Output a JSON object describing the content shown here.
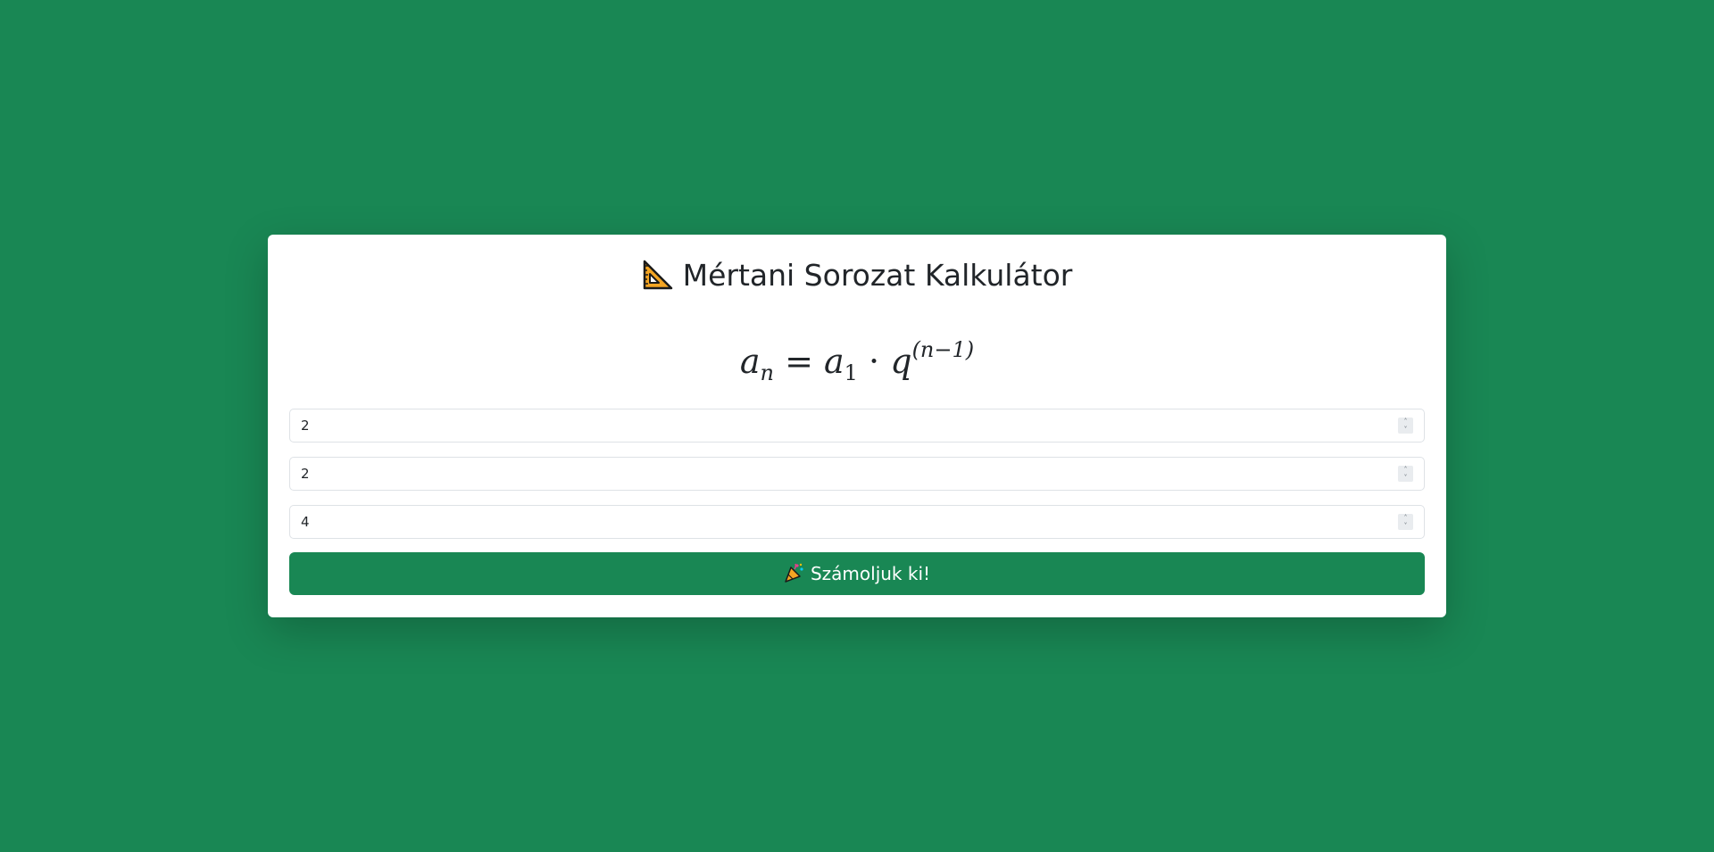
{
  "colors": {
    "background": "#198754",
    "card": "#ffffff",
    "button": "#198754",
    "button_text": "#ffffff"
  },
  "header": {
    "icon": "triangular-ruler-icon",
    "title": "Mértani Sorozat Kalkulátor"
  },
  "formula": {
    "a": "a",
    "n_sub": "n",
    "equals": "=",
    "a1": "a",
    "one_sub": "1",
    "dot": "·",
    "q": "q",
    "exponent": "(n−1)"
  },
  "inputs": [
    {
      "value": "2"
    },
    {
      "value": "2"
    },
    {
      "value": "4"
    }
  ],
  "submit": {
    "icon": "party-popper-icon",
    "label": "Számoljuk ki!"
  }
}
